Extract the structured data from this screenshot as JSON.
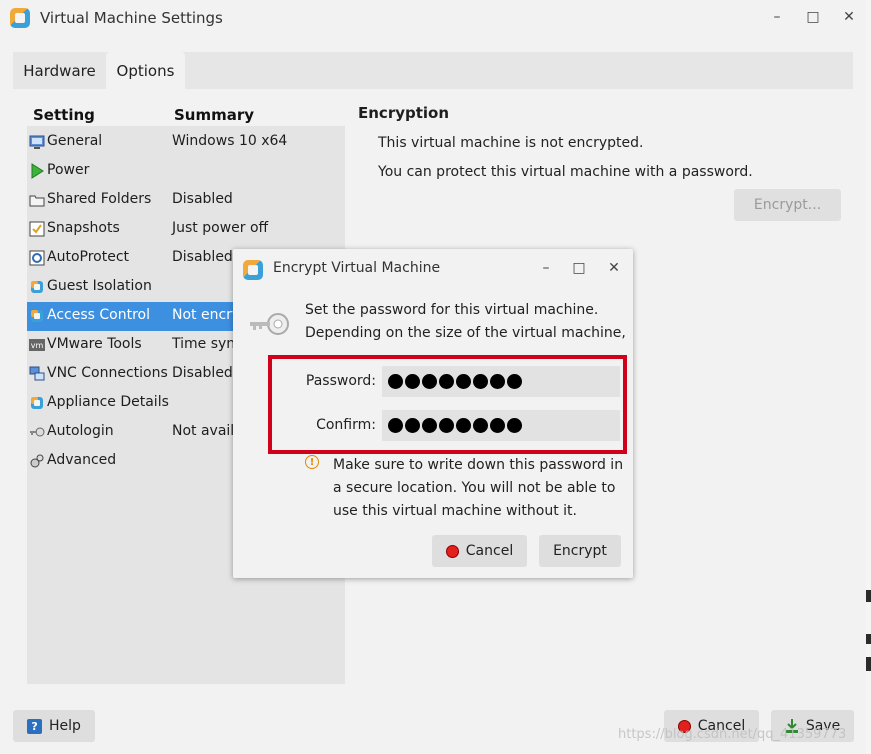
{
  "window": {
    "title": "Virtual Machine Settings",
    "controls": {
      "minimize": "–",
      "maximize": "□",
      "close": "✕"
    }
  },
  "tabs": [
    {
      "label": "Hardware",
      "active": false
    },
    {
      "label": "Options",
      "active": true
    }
  ],
  "settings_list": {
    "headers": {
      "setting": "Setting",
      "summary": "Summary"
    },
    "rows": [
      {
        "label": "General",
        "summary": "Windows 10 x64",
        "icon": "general-icon"
      },
      {
        "label": "Power",
        "summary": "",
        "icon": "power-icon"
      },
      {
        "label": "Shared Folders",
        "summary": "Disabled",
        "icon": "folder-icon"
      },
      {
        "label": "Snapshots",
        "summary": "Just power off",
        "icon": "snapshot-icon"
      },
      {
        "label": "AutoProtect",
        "summary": "Disabled",
        "icon": "autoprotect-icon"
      },
      {
        "label": "Guest Isolation",
        "summary": "",
        "icon": "guest-isolation-icon"
      },
      {
        "label": "Access Control",
        "summary": "Not encry",
        "icon": "access-control-icon",
        "selected": true
      },
      {
        "label": "VMware Tools",
        "summary": "Time syn",
        "icon": "vmware-tools-icon"
      },
      {
        "label": "VNC Connections",
        "summary": "Disabled",
        "icon": "vnc-icon"
      },
      {
        "label": "Appliance Details",
        "summary": "",
        "icon": "appliance-icon"
      },
      {
        "label": "Autologin",
        "summary": "Not avail",
        "icon": "key-icon"
      },
      {
        "label": "Advanced",
        "summary": "",
        "icon": "advanced-icon"
      }
    ]
  },
  "encryption": {
    "title": "Encryption",
    "status": "This virtual machine is not encrypted.",
    "hint": "You can protect this virtual machine with a password.",
    "encrypt_button": "Encrypt..."
  },
  "dialog": {
    "title": "Encrypt Virtual Machine",
    "intro_line1": "Set the password for this virtual machine.",
    "intro_line2": "Depending on the size of the virtual machine,",
    "password_label": "Password:",
    "confirm_label": "Confirm:",
    "password_dots": 8,
    "confirm_dots": 8,
    "warning_line1": "Make sure to write down this password in",
    "warning_line2": "a secure location. You will not be able to",
    "warning_line3": "use this virtual machine without it.",
    "cancel_button": "Cancel",
    "encrypt_button": "Encrypt"
  },
  "footer": {
    "help_button": "Help",
    "cancel_button": "Cancel",
    "save_button": "Save"
  },
  "watermark": "https://blog.csdn.net/qq_41359773",
  "colors": {
    "selection": "#3d8fe0",
    "highlight_box": "#d0021b",
    "cancel_icon": "#e3201b",
    "help_icon": "#2b6fc1"
  }
}
